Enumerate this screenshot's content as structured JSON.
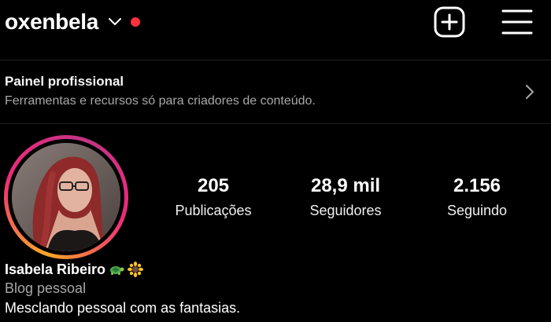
{
  "header": {
    "username": "oxenbela",
    "icons": {
      "switch_account": "chevron-down-icon",
      "notification": "notification-dot-icon",
      "create": "plus-square-icon",
      "menu": "hamburger-menu-icon"
    }
  },
  "professional_panel": {
    "title": "Painel profissional",
    "subtitle": "Ferramentas e recursos só para criadores de conteúdo.",
    "icon": "chevron-right-icon"
  },
  "profile": {
    "avatar_icon": "profile-photo",
    "full_name": "Isabela Ribeiro",
    "name_emojis": [
      "turtle-icon",
      "sunflower-icon"
    ],
    "category": "Blog pessoal",
    "bio": "Mesclando pessoal com as fantasias."
  },
  "stats": [
    {
      "value": "205",
      "label": "Publicações"
    },
    {
      "value": "28,9 mil",
      "label": "Seguidores"
    },
    {
      "value": "2.156",
      "label": "Seguindo"
    }
  ],
  "colors": {
    "background": "#000000",
    "text_primary": "#ffffff",
    "text_secondary": "#a8a8a8",
    "notification_dot": "#ff3040",
    "story_ring_start": "#f9a825",
    "story_ring_mid": "#ee2a7b",
    "story_ring_end": "#c13584",
    "divider": "#1f1f1f"
  }
}
